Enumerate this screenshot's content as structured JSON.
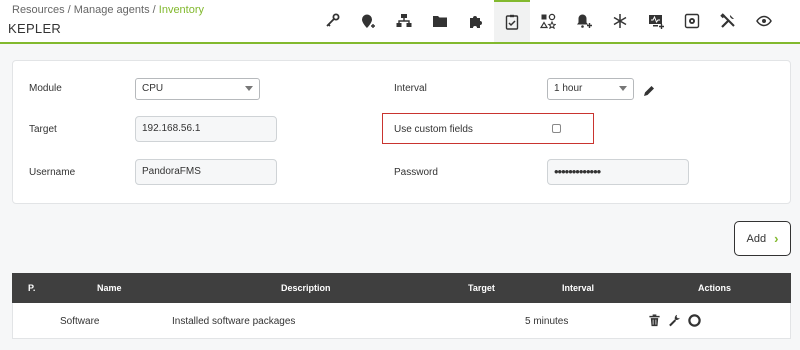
{
  "header": {
    "breadcrumb": [
      "Resources",
      "Manage agents",
      "Inventory"
    ],
    "title": "KEPLER",
    "toolbar_icons": [
      "key-icon",
      "map-pin-add-icon",
      "network-icon",
      "folder-icon",
      "puzzle-icon",
      "checklist-icon",
      "shapes-icon",
      "bell-add-icon",
      "snowflake-icon",
      "monitor-add-icon",
      "settings-square-icon",
      "tools-icon",
      "eye-icon"
    ],
    "selected_icon": "checklist-icon",
    "accent_color": "#82b92e"
  },
  "form": {
    "module_label": "Module",
    "module_value": "CPU",
    "interval_label": "Interval",
    "interval_value": "1 hour",
    "target_label": "Target",
    "target_value": "192.168.56.1",
    "custom_fields_label": "Use custom fields",
    "custom_fields_checked": false,
    "username_label": "Username",
    "username_value": "PandoraFMS",
    "password_label": "Password",
    "password_value": "•••••••••••••"
  },
  "add_button_label": "Add",
  "table": {
    "columns": [
      "P.",
      "Name",
      "Description",
      "Target",
      "Interval",
      "Actions"
    ],
    "rows": [
      {
        "p": "",
        "name": "Software",
        "description": "Installed software packages",
        "target": "",
        "interval": "5 minutes"
      }
    ]
  }
}
